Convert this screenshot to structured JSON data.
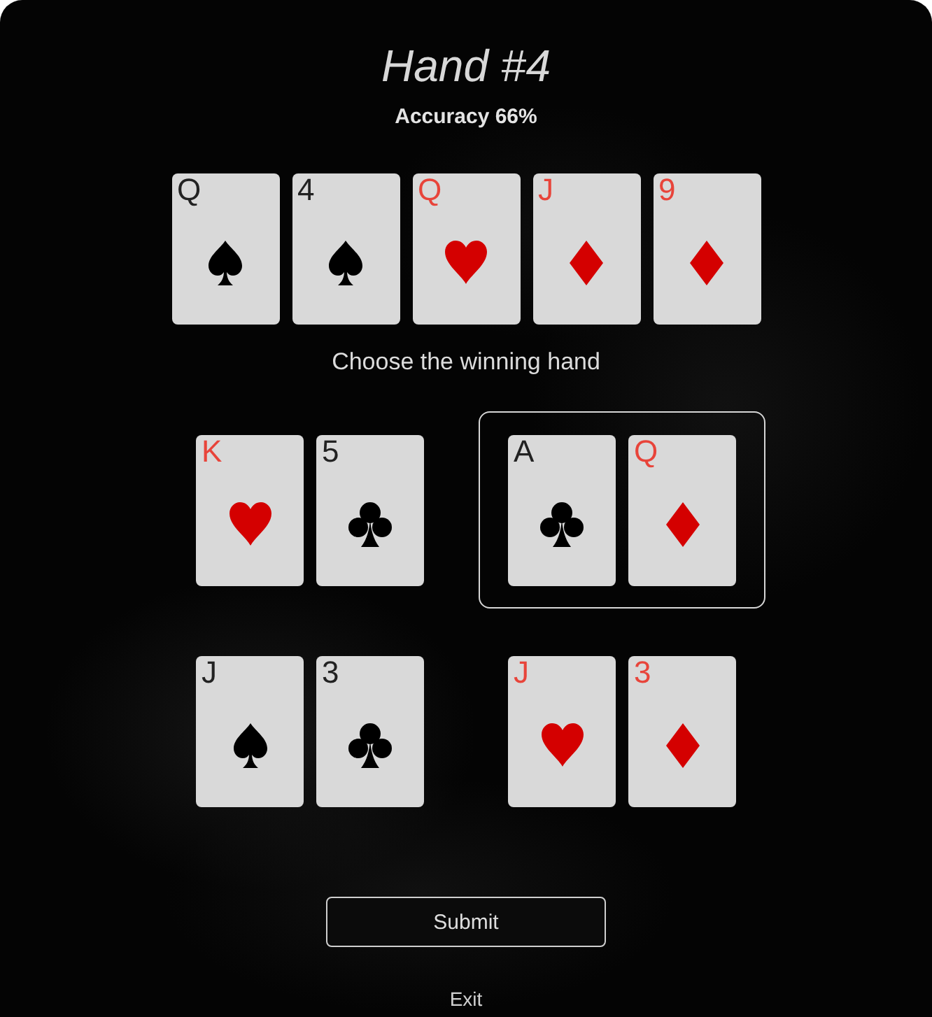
{
  "title": "Hand #4",
  "accuracy": "Accuracy 66%",
  "board": [
    {
      "rank": "Q",
      "kind": "spade"
    },
    {
      "rank": "4",
      "kind": "spade"
    },
    {
      "rank": "Q",
      "kind": "heart"
    },
    {
      "rank": "J",
      "kind": "diamond"
    },
    {
      "rank": "9",
      "kind": "diamond"
    }
  ],
  "prompt": "Choose the winning hand",
  "hands": [
    {
      "selected": false,
      "cards": [
        {
          "rank": "K",
          "kind": "heart"
        },
        {
          "rank": "5",
          "kind": "club"
        }
      ]
    },
    {
      "selected": true,
      "cards": [
        {
          "rank": "A",
          "kind": "club"
        },
        {
          "rank": "Q",
          "kind": "diamond"
        }
      ]
    },
    {
      "selected": false,
      "cards": [
        {
          "rank": "J",
          "kind": "spade"
        },
        {
          "rank": "3",
          "kind": "club"
        }
      ]
    },
    {
      "selected": false,
      "cards": [
        {
          "rank": "J",
          "kind": "heart"
        },
        {
          "rank": "3",
          "kind": "diamond"
        }
      ]
    }
  ],
  "buttons": {
    "submit": "Submit",
    "exit": "Exit"
  }
}
